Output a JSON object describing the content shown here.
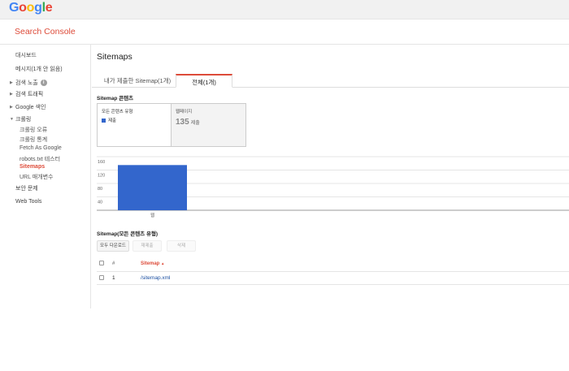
{
  "header": {
    "logo_letters": [
      {
        "char": "G",
        "color": "#4285f4"
      },
      {
        "char": "o",
        "color": "#ea4335"
      },
      {
        "char": "o",
        "color": "#fbbc05"
      },
      {
        "char": "g",
        "color": "#4285f4"
      },
      {
        "char": "l",
        "color": "#34a853"
      },
      {
        "char": "e",
        "color": "#ea4335"
      }
    ],
    "app_title": "Search Console"
  },
  "sidebar": {
    "dashboard": "대시보드",
    "messages": "메시지(1개 안 읽음)",
    "search_appearance": "검색 노출",
    "search_traffic": "검색 트래픽",
    "google_index": "Google 색인",
    "crawl": "크롤링",
    "crawl_errors": "크롤링 오류",
    "crawl_stats": "크롤링 통계",
    "fetch_as_google": "Fetch As Google",
    "robots_tester": "robots.txt 테스터",
    "sitemaps": "Sitemaps",
    "url_params": "URL 매개변수",
    "security_issues": "보안 문제",
    "web_tools": "Web Tools",
    "info_icon_glyph": "i"
  },
  "main": {
    "title": "Sitemaps",
    "tabs": [
      {
        "label": "내가 제출한 Sitemap(1개)",
        "active": false
      },
      {
        "label": "전체(1개)",
        "active": true
      }
    ],
    "content_heading": "Sitemap 콘텐츠",
    "card_all_types": "모든 콘텐츠 유형",
    "card_legend_submitted": "제출",
    "card_webpages": "웹페이지",
    "card_webpages_count": "135",
    "card_webpages_count_label": "제출",
    "table_heading": "Sitemap(모든 콘텐츠 유형)",
    "buttons": {
      "download_all": "모두 다운로드",
      "resubmit": "재제출",
      "delete": "삭제"
    },
    "table": {
      "col_num": "#",
      "col_sitemap": "Sitemap",
      "sort_indicator": "▲",
      "rows": [
        {
          "num": "1",
          "sitemap": "/sitemap.xml"
        }
      ]
    }
  },
  "colors": {
    "accent": "#dd4b39",
    "bar": "#3366cc",
    "link": "#1a4ea0"
  },
  "chart_data": {
    "type": "bar",
    "categories": [
      "웹"
    ],
    "series": [
      {
        "name": "제출",
        "values": [
          135
        ]
      }
    ],
    "ylim": [
      0,
      160
    ],
    "yticks": [
      40,
      80,
      120,
      160
    ],
    "grid": true
  }
}
